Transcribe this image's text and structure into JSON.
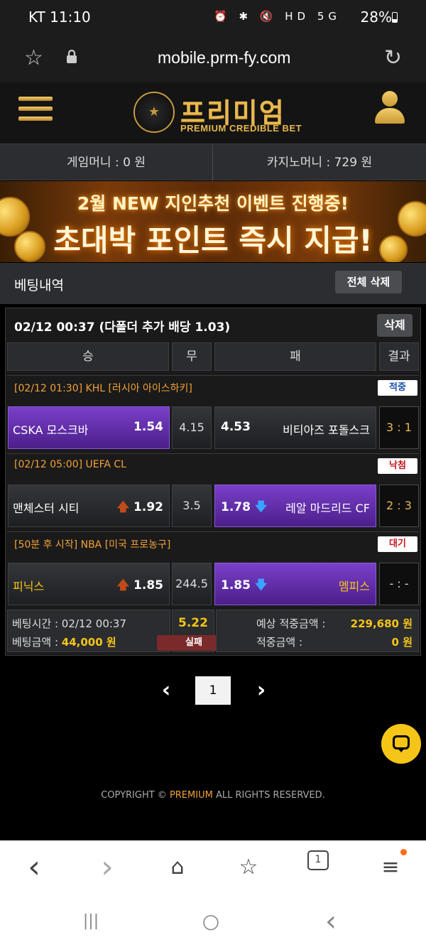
{
  "status_bar": {
    "carrier_time": "KT 11:10",
    "icons": "⏰ ✱ 🔇 HD 5G",
    "battery": "28%"
  },
  "url_bar": {
    "url": "mobile.prm-fy.com"
  },
  "header": {
    "logo_title": "프리미엄",
    "logo_subtitle": "PREMIUM CREDIBLE BET",
    "badge_text": "★"
  },
  "money": {
    "game_money": "게임머니 : 0 원",
    "casino_money": "카지노머니 : 729 원"
  },
  "banner": {
    "line1": "2월 NEW 지인추천 이벤트 진행중!",
    "line2": "초대박 포인트 즉시 지급!"
  },
  "section": {
    "title": "베팅내역",
    "delete_all_label": "전체 삭제"
  },
  "bet": {
    "summary": "02/12 00:37 (다폴더 추가 배당 1.03)",
    "delete_label": "삭제",
    "columns": {
      "win": "승",
      "draw": "무",
      "lose": "패",
      "result": "결과"
    },
    "games": [
      {
        "league": "[02/12 01:30] KHL [러시아 아이스하키]",
        "status": "적중",
        "status_color": "#1d4fa8",
        "home": "CSKA 모스크바",
        "home_odds": "1.54",
        "home_arrow": "",
        "draw": "4.15",
        "away": "비티아즈 포돌스크",
        "away_odds": "4.53",
        "away_arrow": "",
        "score": "3 : 1"
      },
      {
        "league": "[02/12 05:00] UEFA CL",
        "status": "낙첨",
        "status_color": "#c4161c",
        "home": "맨체스터 시티",
        "home_odds": "1.92",
        "home_arrow": "🡅",
        "draw": "3.5",
        "away": "레알 마드리드 CF",
        "away_odds": "1.78",
        "away_arrow": "🡇",
        "score": "2 : 3"
      },
      {
        "league": "[50분 후 시작] NBA [미국 프로농구]",
        "status": "대기",
        "status_color": "#c4161c",
        "home": "피닉스",
        "home_odds": "1.85",
        "home_arrow": "🡅",
        "draw": "244.5",
        "away": "멤피스",
        "away_odds": "1.85",
        "away_arrow": "🡇",
        "score": "- : -"
      }
    ],
    "footer": {
      "bet_time_label": "베팅시간 : 02/12 00:37",
      "bet_amount_label": "베팅금액 : ",
      "bet_amount": "44,000 원",
      "total_odds": "5.22",
      "result": "실패",
      "expected_label": "예상 적중금액 :",
      "expected_value": "229,680 원",
      "win_label": "적중금액 :",
      "win_value": "0 원"
    }
  },
  "pagination": {
    "prev": "‹",
    "page": "1",
    "next": "›"
  },
  "copyright": {
    "prefix": "COPYRIGHT © ",
    "brand": "PREMIUM",
    "suffix": " ALL RIGHTS RESERVED."
  },
  "browser_nav": {
    "back": "‹",
    "forward": "›",
    "home": "⌂",
    "bookmark": "☆",
    "tabs_count": "1",
    "menu": "≡"
  },
  "android_nav": {
    "recents": "|||",
    "home": "○",
    "back": "‹"
  }
}
